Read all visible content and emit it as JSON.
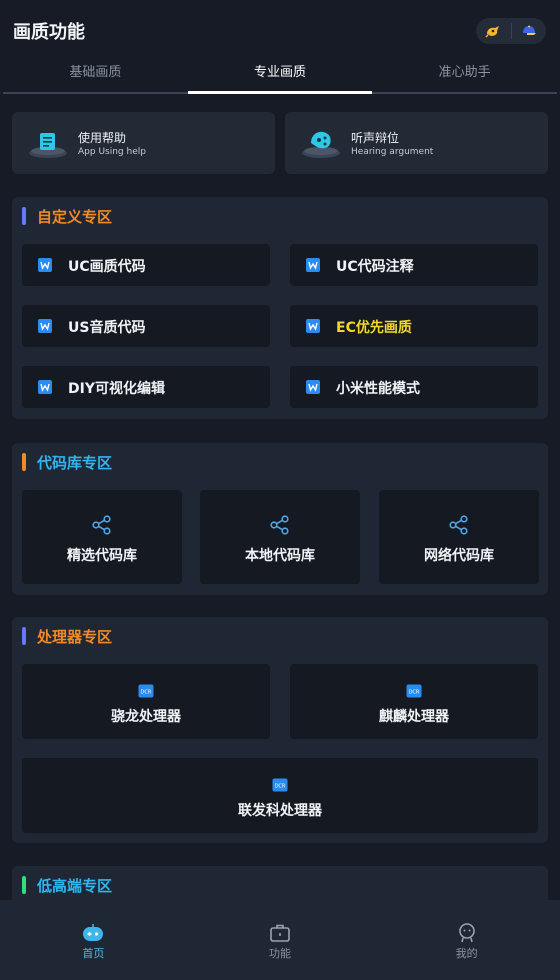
{
  "app_title": "画质功能",
  "tabs": [
    {
      "label": "基础画质",
      "active": false
    },
    {
      "label": "专业画质",
      "active": true
    },
    {
      "label": "准心助手",
      "active": false
    }
  ],
  "help_cards": [
    {
      "title": "使用帮助",
      "subtitle": "App Using help",
      "icon": "help-doc-icon"
    },
    {
      "title": "听声辩位",
      "subtitle": "Hearing argument",
      "icon": "hearing-icon"
    }
  ],
  "sections": {
    "custom": {
      "title": "自定义专区",
      "title_color": "#f08a24",
      "bar_color": "#6677ff",
      "items": [
        {
          "label": "UC画质代码",
          "color": "#f1f3f6"
        },
        {
          "label": "UC代码注释",
          "color": "#f1f3f6"
        },
        {
          "label": "US音质代码",
          "color": "#f1f3f6"
        },
        {
          "label": "EC优先画质",
          "color": "#f2d82c"
        },
        {
          "label": "DIY可视化编辑",
          "color": "#f1f3f6"
        },
        {
          "label": "小米性能模式",
          "color": "#f1f3f6"
        }
      ]
    },
    "codelib": {
      "title": "代码库专区",
      "title_color": "#2fb6f0",
      "bar_color": "#f08a24",
      "items": [
        {
          "label": "精选代码库"
        },
        {
          "label": "本地代码库"
        },
        {
          "label": "网络代码库"
        }
      ]
    },
    "processor": {
      "title": "处理器专区",
      "title_color": "#f08a24",
      "bar_color": "#6677ff",
      "chip_text": "DCR",
      "items": [
        {
          "label": "骁龙处理器"
        },
        {
          "label": "麒麟处理器"
        },
        {
          "label": "联发科处理器"
        }
      ]
    },
    "tier": {
      "title": "低高端专区",
      "title_color": "#2fb6f0",
      "bar_color": "#2ee07a"
    }
  },
  "bottom_nav": [
    {
      "label": "首页",
      "icon": "gamepad-icon",
      "active": true
    },
    {
      "label": "功能",
      "icon": "toolbox-icon",
      "active": false
    },
    {
      "label": "我的",
      "icon": "profile-icon",
      "active": false
    }
  ],
  "colors": {
    "accent": "#4fb8e8",
    "doc_icon": "#2a8cf0",
    "share_icon": "#4ea7ea"
  }
}
